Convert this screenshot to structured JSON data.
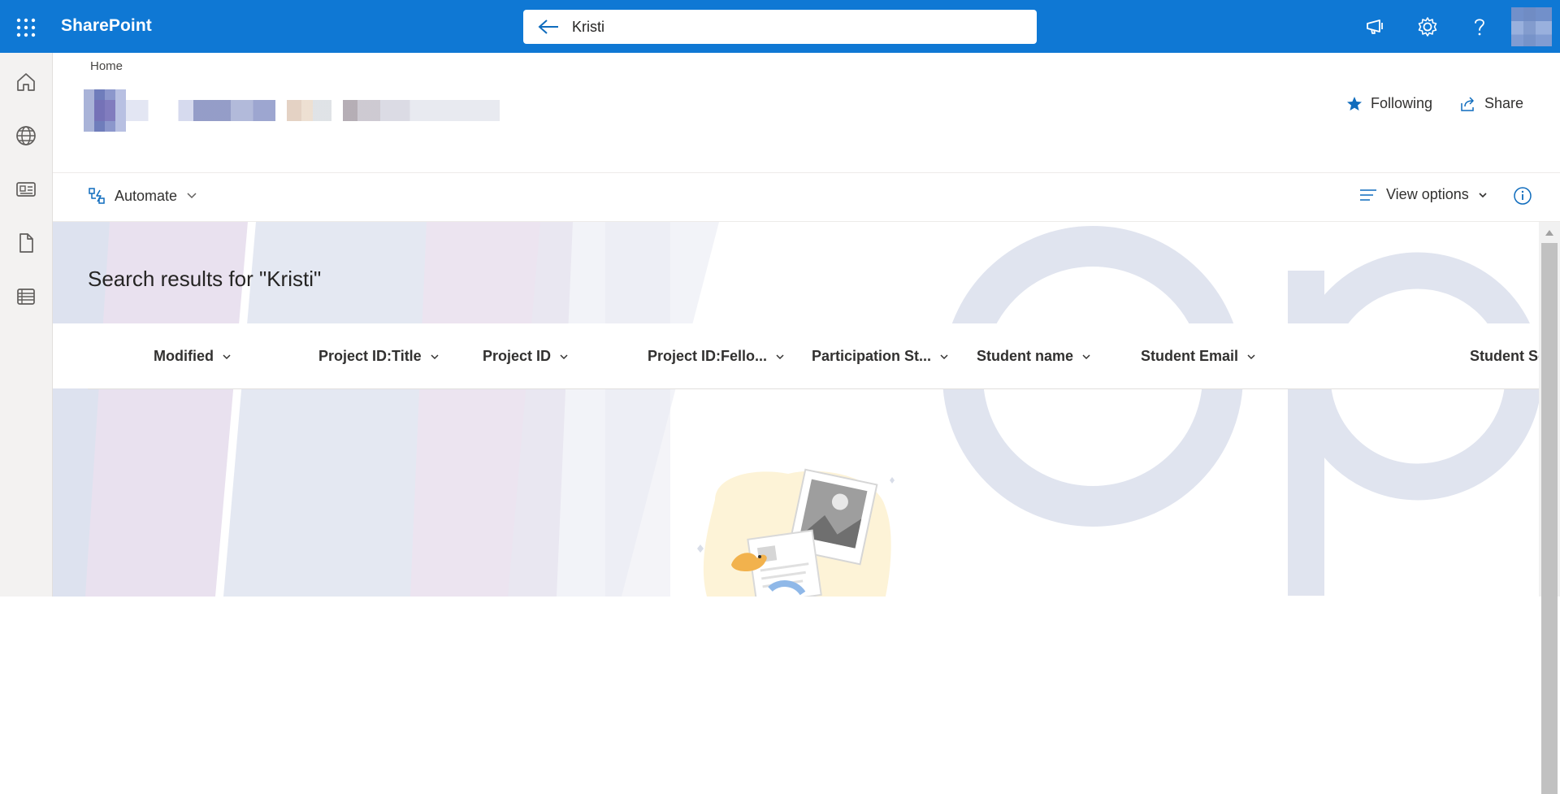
{
  "suite": {
    "brand": "SharePoint",
    "search_value": "Kristi",
    "icons": [
      "app-launcher-icon",
      "megaphone-icon",
      "gear-icon",
      "help-icon"
    ]
  },
  "colors": {
    "suite_bar": "#0f78d4",
    "accent": "#0f6cbd",
    "rail": "#f3f2f1"
  },
  "rail": {
    "items": [
      "home-icon",
      "globe-icon",
      "news-icon",
      "document-icon",
      "list-icon"
    ]
  },
  "header": {
    "breadcrumb": "Home",
    "follow_label": "Following",
    "share_label": "Share"
  },
  "commandbar": {
    "automate_label": "Automate",
    "view_options_label": "View options"
  },
  "results": {
    "title": "Search results for \"Kristi\"",
    "columns": [
      "Modified",
      "Project ID:Title",
      "Project ID",
      "Project ID:Fello...",
      "Participation St...",
      "Student name",
      "Student Email",
      "Student Sc"
    ]
  }
}
